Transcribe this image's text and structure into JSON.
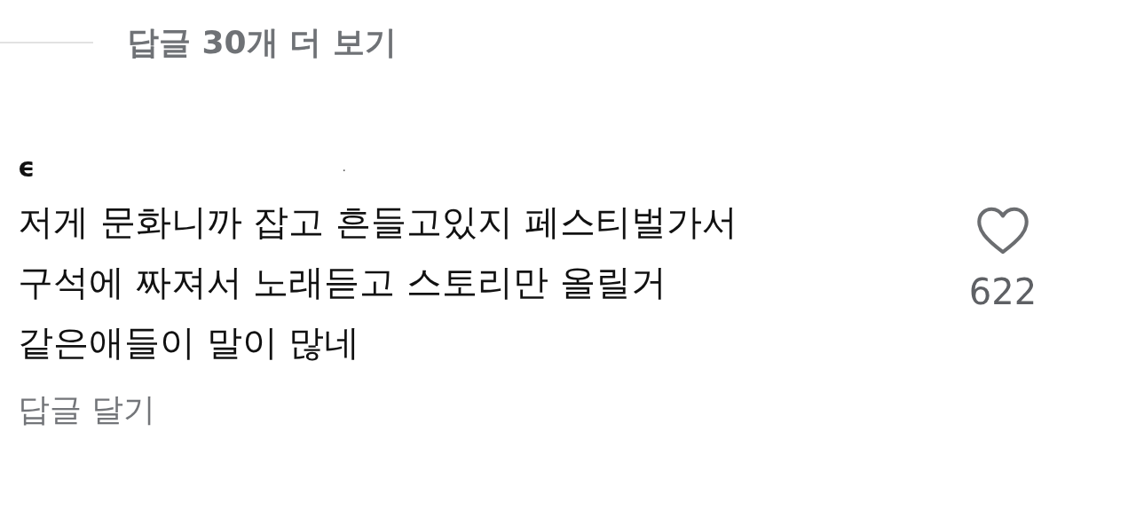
{
  "more_replies": {
    "label": "답글 30개 더 보기"
  },
  "comment": {
    "author_start": "ϵ",
    "author_end": ".",
    "lines": [
      "저게 문화니까 잡고 흔들고있지 페스티벌가서",
      "구석에 짜져서 노래듣고 스토리만 올릴거",
      "같은애들이 말이 많네"
    ],
    "liked": false,
    "like_count": "622",
    "reply_label": "답글 달기"
  }
}
